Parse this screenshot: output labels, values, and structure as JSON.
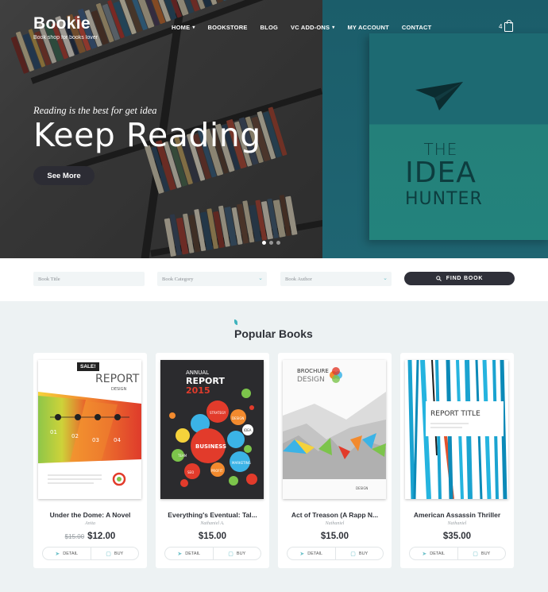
{
  "brand": {
    "name": "Bookie",
    "tagline": "Book shop for books lover"
  },
  "nav": {
    "items": [
      {
        "label": "Home",
        "dropdown": true
      },
      {
        "label": "Bookstore",
        "dropdown": false
      },
      {
        "label": "Blog",
        "dropdown": false
      },
      {
        "label": "VC Add-ons",
        "dropdown": true
      },
      {
        "label": "My Account",
        "dropdown": false
      },
      {
        "label": "Contact",
        "dropdown": false
      }
    ],
    "cart_count": "4",
    "cart_icon": "shopping-bag-icon"
  },
  "hero": {
    "subtitle": "Reading is the best for get idea",
    "title": "Keep Reading",
    "button": "See More",
    "slides": 3,
    "active_slide": 1,
    "cover": {
      "line1": "THE",
      "line2": "IDEA",
      "line3": "HUNTER"
    }
  },
  "search": {
    "title_placeholder": "Book Title",
    "category_placeholder": "Book Category",
    "author_placeholder": "Book Author",
    "button": "FIND BOOK",
    "button_icon": "search-icon"
  },
  "popular": {
    "title": "Popular Books",
    "books": [
      {
        "title": "Under the Dome: A Novel",
        "author": "Anita",
        "old_price": "$15.00",
        "price": "$12.00",
        "badge": "SALE!",
        "detail": "Detail",
        "buy": "Buy",
        "cover_text": [
          "REPORT",
          "DESIGN"
        ]
      },
      {
        "title": "Everything's Eventual: Tal...",
        "author": "Nathaniel A.",
        "old_price": "",
        "price": "$15.00",
        "badge": "",
        "detail": "Detail",
        "buy": "Buy",
        "cover_text": [
          "ANNUAL",
          "REPORT",
          "2015",
          "BUSINESS",
          "STRATEGY",
          "DESIGN",
          "IDEA",
          "TEAM",
          "PROFIT",
          "MARKETING",
          "SEO"
        ]
      },
      {
        "title": "Act of Treason (A Rapp N...",
        "author": "Nathaniel",
        "old_price": "",
        "price": "$15.00",
        "badge": "",
        "detail": "Detail",
        "buy": "Buy",
        "cover_text": [
          "BROCHURE",
          "DESIGN"
        ]
      },
      {
        "title": "American Assassin Thriller",
        "author": "Nathaniel",
        "old_price": "",
        "price": "$35.00",
        "badge": "",
        "detail": "Detail",
        "buy": "Buy",
        "cover_text": [
          "REPORT TITLE"
        ]
      }
    ]
  },
  "colors": {
    "accent": "#3fb3bd",
    "dark": "#2f3039",
    "hero_teal": "#1d6a72"
  }
}
